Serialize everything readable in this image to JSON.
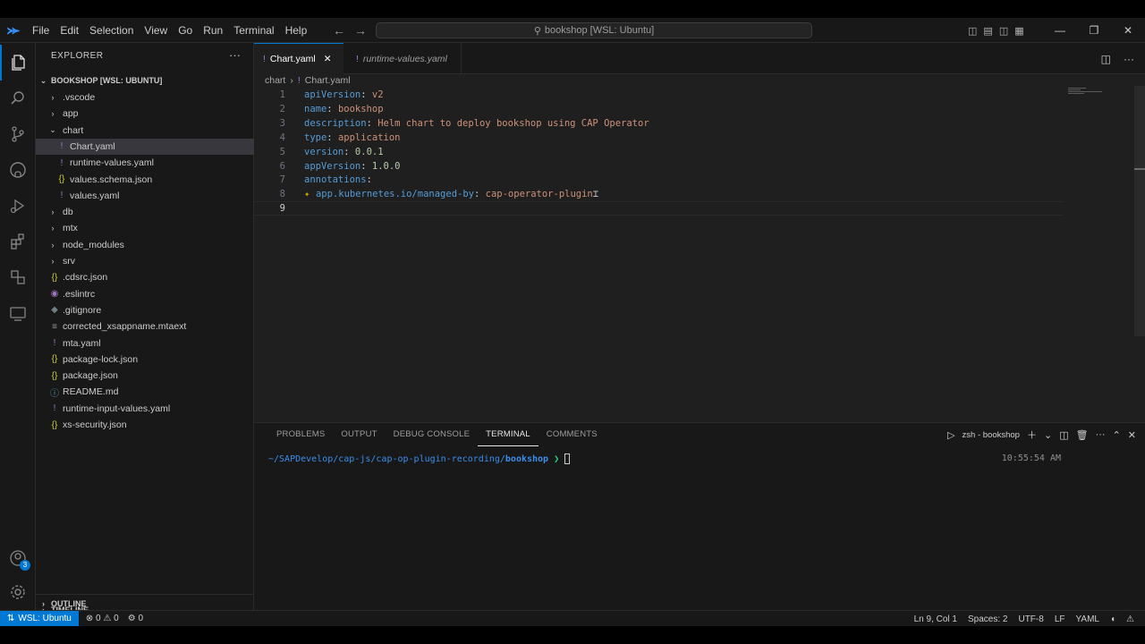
{
  "titlebar": {
    "menu": [
      "File",
      "Edit",
      "Selection",
      "View",
      "Go",
      "Run",
      "Terminal",
      "Help"
    ],
    "command_center": "bookshop [WSL: Ubuntu]"
  },
  "explorer": {
    "title": "EXPLORER",
    "root": "BOOKSHOP [WSL: UBUNTU]",
    "items": [
      {
        "label": ".vscode",
        "type": "folder"
      },
      {
        "label": "app",
        "type": "folder"
      },
      {
        "label": "chart",
        "type": "folder-open"
      },
      {
        "label": "Chart.yaml",
        "type": "yaml"
      },
      {
        "label": "runtime-values.yaml",
        "type": "yaml"
      },
      {
        "label": "values.schema.json",
        "type": "json"
      },
      {
        "label": "values.yaml",
        "type": "yaml"
      },
      {
        "label": "db",
        "type": "folder"
      },
      {
        "label": "mtx",
        "type": "folder"
      },
      {
        "label": "node_modules",
        "type": "folder"
      },
      {
        "label": "srv",
        "type": "folder"
      },
      {
        "label": ".cdsrc.json",
        "type": "json"
      },
      {
        "label": ".eslintrc",
        "type": "eslint"
      },
      {
        "label": ".gitignore",
        "type": "git"
      },
      {
        "label": "corrected_xsappname.mtaext",
        "type": "txt"
      },
      {
        "label": "mta.yaml",
        "type": "yaml"
      },
      {
        "label": "package-lock.json",
        "type": "json"
      },
      {
        "label": "package.json",
        "type": "json"
      },
      {
        "label": "README.md",
        "type": "md"
      },
      {
        "label": "runtime-input-values.yaml",
        "type": "yaml"
      },
      {
        "label": "xs-security.json",
        "type": "json"
      }
    ],
    "outline": "OUTLINE",
    "timeline": "TIMELINE"
  },
  "tabs": [
    {
      "label": "Chart.yaml",
      "active": true
    },
    {
      "label": "runtime-values.yaml",
      "active": false
    }
  ],
  "breadcrumb": {
    "folder": "chart",
    "file": "Chart.yaml"
  },
  "code_lines": [
    {
      "n": "1",
      "key": "apiVersion",
      "val": "v2",
      "kind": "str"
    },
    {
      "n": "2",
      "key": "name",
      "val": "bookshop",
      "kind": "str"
    },
    {
      "n": "3",
      "key": "description",
      "val": "Helm chart to deploy bookshop using CAP Operator",
      "kind": "str"
    },
    {
      "n": "4",
      "key": "type",
      "val": "application",
      "kind": "str"
    },
    {
      "n": "5",
      "key": "version",
      "val": "0.0.1",
      "kind": "num"
    },
    {
      "n": "6",
      "key": "appVersion",
      "val": "1.0.0",
      "kind": "num"
    },
    {
      "n": "7",
      "key": "annotations",
      "val": "",
      "kind": "str"
    },
    {
      "n": "8",
      "key": "  app.kubernetes.io/managed-by",
      "val": "cap-operator-plugin",
      "kind": "str"
    },
    {
      "n": "9",
      "key": "",
      "val": "",
      "kind": "str"
    }
  ],
  "panel": {
    "tabs": [
      "PROBLEMS",
      "OUTPUT",
      "DEBUG CONSOLE",
      "TERMINAL",
      "COMMENTS"
    ],
    "active_tab": "TERMINAL",
    "terminal_name": "zsh - bookshop",
    "prompt_path": "~/SAPDevelop/cap-js/cap-op-plugin-recording/",
    "prompt_dir": "bookshop",
    "prompt_arrow": "❯",
    "time": "10:55:54 AM"
  },
  "status": {
    "remote": "WSL: Ubuntu",
    "errors": "0",
    "warnings": "0",
    "ports": "0",
    "position": "Ln 9, Col 1",
    "spaces": "Spaces: 2",
    "encoding": "UTF-8",
    "eol": "LF",
    "language": "YAML"
  },
  "colors": {
    "accent": "#0078d4",
    "yaml_key": "#569cd6",
    "yaml_string": "#ce9178",
    "yaml_number": "#b5cea8"
  }
}
